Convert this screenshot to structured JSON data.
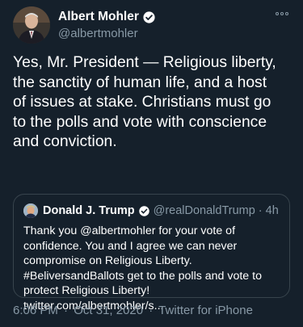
{
  "author": {
    "display_name": "Albert Mohler",
    "handle": "@albertmohler",
    "verified": true
  },
  "more_icon": "more-options-icon",
  "tweet": {
    "lines": [
      "Yes, Mr. President — Religious liberty,",
      "the sanctity of human life, and a host",
      "of issues at stake. Christians must go",
      "to the polls and vote with conscience",
      "and conviction."
    ]
  },
  "quoted_tweet": {
    "display_name": "Donald J. Trump",
    "handle": "@realDonaldTrump",
    "separator": "·",
    "time": "4h",
    "verified": true,
    "lines": [
      "Thank you @albertmohler for your vote of",
      "confidence. You and I agree we can never",
      "compromise on Religious Liberty.",
      "#BeliversandBallots get to the polls and vote to",
      "protect Religious Liberty!",
      "twitter.com/albertmohler/s..."
    ]
  },
  "meta": {
    "time": "6:06 PM",
    "sep1": "·",
    "date": "Oct 31, 2020",
    "sep2": "·",
    "source": "Twitter for iPhone"
  },
  "colors": {
    "background": "#15202b",
    "secondary_text": "#8899a6",
    "border": "#38444d",
    "verified": "#ffffff"
  }
}
